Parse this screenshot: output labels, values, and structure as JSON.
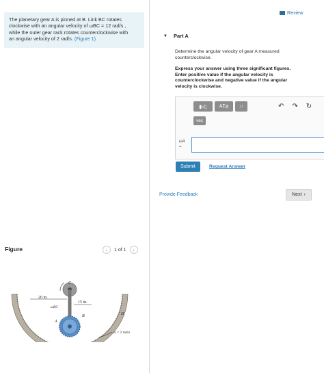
{
  "problem": {
    "line1": "The planetary gear A is pinned at B. Link BC rotates",
    "line2": "clockwise with an angular velocity of ωBC = 12 rad/s ,",
    "line3": "while the outer gear rack rotates counterclockwise with",
    "line4_text": "an angular velocity of 2 rad/s.",
    "figure_link": "(Figure 1)"
  },
  "figure_panel": {
    "title": "Figure",
    "pager_text": "1 of 1",
    "labels": {
      "dim_20": "20 in.",
      "dim_15": "15 in.",
      "omega_bc": "ωBC",
      "point_c": "C",
      "point_b": "B",
      "point_a": "A",
      "point_d": "D",
      "omega_rack": "ω = 2 rad/s"
    }
  },
  "header": {
    "review_label": "Review"
  },
  "part": {
    "label": "Part A",
    "question_line1": "Determine the angular velocity of gear A measured",
    "question_line2": "counterclockwise.",
    "instruct_line1": "Express your answer using three significant figures.",
    "instruct_line2": "Enter positive value if the angular velocity is",
    "instruct_line3": "counterclockwise and negative value if the angular",
    "instruct_line4": "velocity is clockwise."
  },
  "editor": {
    "btn_templates": "▮√▯",
    "btn_greek": "ΑΣφ",
    "btn_arrows": "↓↑",
    "btn_vec": "vec",
    "undo": "↶",
    "redo": "↷",
    "reset": "↻",
    "answer_label_top": "ωA",
    "answer_label_eq": "=",
    "answer_value": ""
  },
  "buttons": {
    "submit": "Submit",
    "request_answer": "Request Answer",
    "provide_feedback": "Provide Feedback",
    "next": "Next"
  },
  "colors": {
    "link": "#2b7bb9",
    "submit_bg": "#2c80b4",
    "problem_bg": "#e8f3f8",
    "gear_blue": "#5b8fc6"
  }
}
